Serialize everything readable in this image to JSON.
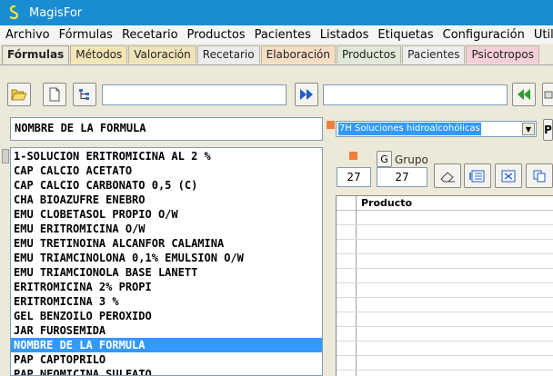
{
  "window": {
    "title": "MagisFor"
  },
  "menu": [
    "Archivo",
    "Fórmulas",
    "Recetario",
    "Productos",
    "Pacientes",
    "Listados",
    "Etiquetas",
    "Configuración",
    "Utilidades"
  ],
  "tabs": [
    {
      "label": "Fórmulas",
      "color": "#ece9d8"
    },
    {
      "label": "Métodos",
      "color": "#f3e6b5"
    },
    {
      "label": "Valoración",
      "color": "#efe4b8"
    },
    {
      "label": "Recetario",
      "color": "#ececec"
    },
    {
      "label": "Elaboración",
      "color": "#f7ddc4"
    },
    {
      "label": "Productos",
      "color": "#e0e8d8"
    },
    {
      "label": "Pacientes",
      "color": "#eeeeee"
    },
    {
      "label": "Psicotropos",
      "color": "#f6cfd7"
    }
  ],
  "toolbar": {
    "open_icon": "folder-open-icon",
    "new_icon": "new-document-icon",
    "tree_icon": "tree-structure-icon",
    "forward_icon": "double-arrow-right-icon",
    "back_icon": "double-arrow-left-icon",
    "search1_value": "",
    "search2_value": ""
  },
  "formula": {
    "title": "NOMBRE DE LA FORMULA",
    "type_selected": "7H Soluciones hidroalcohólicas",
    "group_button": "G",
    "group_label": "Grupo",
    "code_left": "27",
    "group_value": "27"
  },
  "formula_list": [
    "1-SOLUCION ERITROMICINA AL 2 %",
    "CAP CALCIO ACETATO",
    "CAP CALCIO CARBONATO 0,5 (C)",
    "CHA BIOAZUFRE ENEBRO",
    "EMU CLOBETASOL PROPIO O/W",
    "EMU ERITROMICINA  O/W",
    "EMU TRETINOINA ALCANFOR CALAMINA",
    "EMU TRIAMCINOLONA 0,1% EMULSION O/W",
    "EMU TRIAMCIONOLA BASE LANETT",
    "ERITROMICINA 2% PROPI",
    "ERITROMICINA 3 %",
    "GEL BENZOILO PEROXIDO",
    "JAR FUROSEMIDA",
    "NOMBRE DE LA FORMULA",
    "PAP CAPTOPRILO",
    "PAP NEOMICINA  SULFATO"
  ],
  "selected_index": 13,
  "grid": {
    "column_producto": "Producto"
  },
  "colors": {
    "titlebar": "#1a8cd1",
    "selection": "#3399ff",
    "accent_orange": "#f07f3c",
    "green_arrow": "#2e9e2e",
    "blue_arrow": "#1d5ec9"
  }
}
